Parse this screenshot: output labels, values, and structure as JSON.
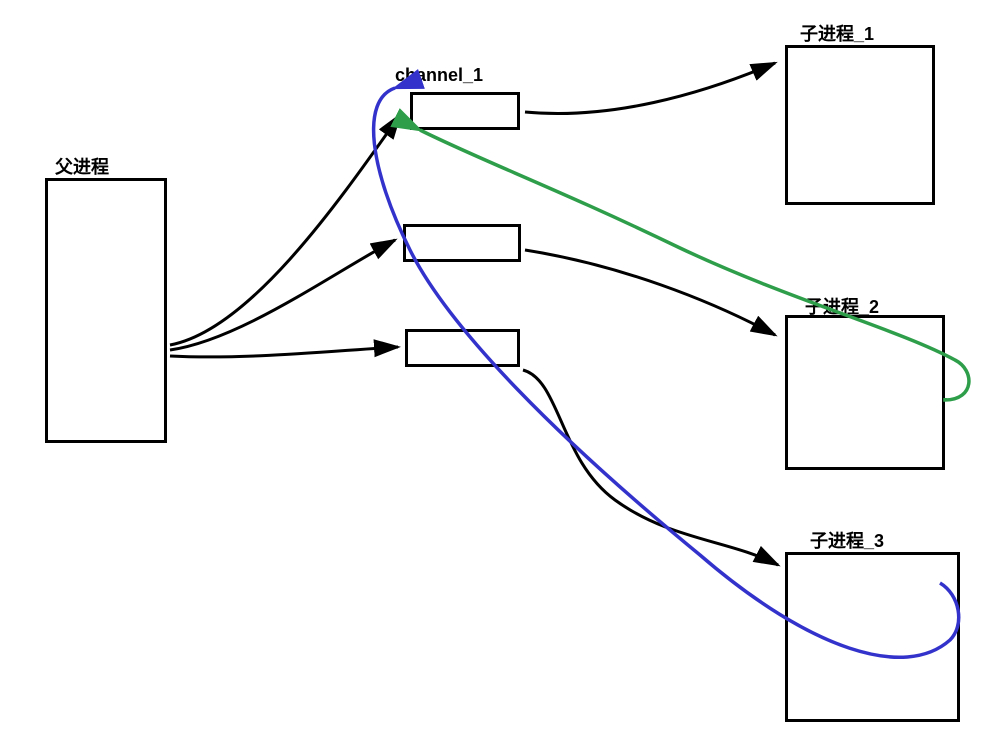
{
  "diagram": {
    "parent_label": "父进程",
    "channel_label": "channel_1",
    "child1_label": "子进程_1",
    "child2_label": "子进程_2",
    "child3_label": "子进程_3"
  },
  "colors": {
    "stroke_black": "#000000",
    "stroke_blue": "#3333cc",
    "stroke_green": "#2e9e4a"
  },
  "description": "Process communication diagram: parent process connects to three channels; channels connect to three child processes; blue curved arrow from child_3 back to channel_1; green curved arrow from child_2 back to channel_1."
}
